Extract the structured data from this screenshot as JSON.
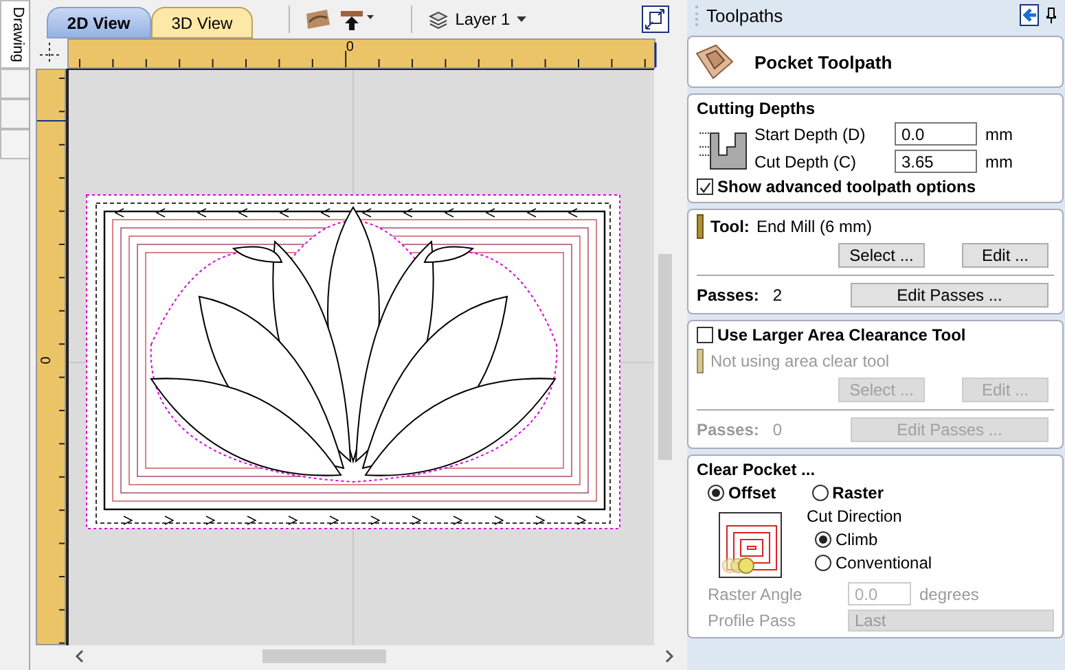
{
  "side_tabs": [
    {
      "label": "Drawing",
      "selected": true
    }
  ],
  "view_tabs": [
    {
      "label": "2D View",
      "selected": true
    },
    {
      "label": "3D View",
      "selected": false
    }
  ],
  "toolbar": {
    "layer": "Layer 1"
  },
  "rulers": {
    "top_label": "0",
    "left_label": "0"
  },
  "panel": {
    "title": "Toolpaths",
    "header": "Pocket Toolpath",
    "cutting_depths": {
      "title": "Cutting Depths",
      "fields": [
        {
          "label": "Start Depth (D)",
          "value": "0.0",
          "unit": "mm"
        },
        {
          "label": "Cut Depth (C)",
          "value": "3.65",
          "unit": "mm"
        }
      ],
      "advanced": {
        "label": "Show advanced toolpath options",
        "checked": true
      }
    },
    "tool": {
      "label": "Tool:",
      "name": "End Mill (6 mm)",
      "buttons": [
        "Select ...",
        "Edit ..."
      ],
      "passes_label": "Passes:",
      "passes": "2",
      "passes_button": "Edit Passes ..."
    },
    "clearance": {
      "label": "Use Larger Area Clearance Tool",
      "checked": false,
      "disabled": true,
      "tool": "Not using area clear tool",
      "buttons": [
        "Select ...",
        "Edit ..."
      ],
      "passes_label": "Passes:",
      "passes": "0",
      "passes_button": "Edit Passes ..."
    },
    "clear_pocket": {
      "title": "Clear Pocket ...",
      "strategies": [
        {
          "label": "Offset",
          "selected": true
        },
        {
          "label": "Raster",
          "selected": false
        }
      ],
      "direction_title": "Cut Direction",
      "directions": [
        {
          "label": "Climb",
          "selected": true
        },
        {
          "label": "Conventional",
          "selected": false
        }
      ],
      "raster_angle": {
        "label": "Raster Angle",
        "value": "0.0",
        "unit": "degrees",
        "disabled": true
      },
      "profile_pass": {
        "label": "Profile Pass",
        "value": "Last",
        "disabled": true
      }
    }
  }
}
